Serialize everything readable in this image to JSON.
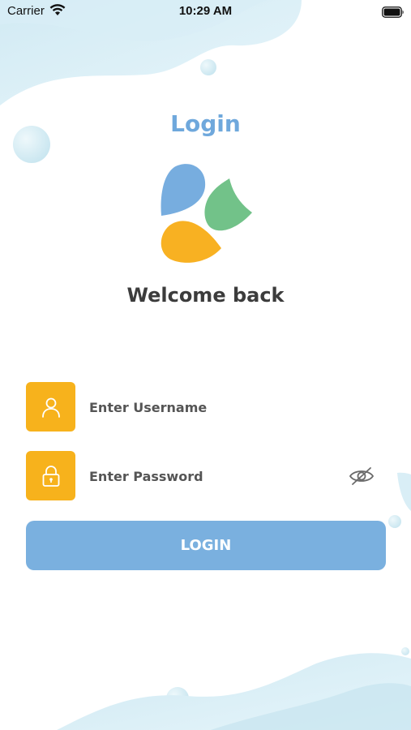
{
  "status_bar": {
    "carrier": "Carrier",
    "time": "10:29 AM"
  },
  "login": {
    "title": "Login",
    "welcome": "Welcome back",
    "username": {
      "placeholder": "Enter Username",
      "value": "",
      "icon": "user-icon"
    },
    "password": {
      "placeholder": "Enter Password",
      "value": "",
      "icon": "lock-icon",
      "toggle_icon": "eye-off-icon"
    },
    "button_label": "LOGIN"
  },
  "colors": {
    "title": "#6fa8dc",
    "icon_box": "#f7b21c",
    "button": "#7ab0df",
    "logo_blue": "#77addf",
    "logo_green": "#72c289",
    "logo_orange": "#f8b122",
    "background_wave": "#d4ecf4"
  }
}
